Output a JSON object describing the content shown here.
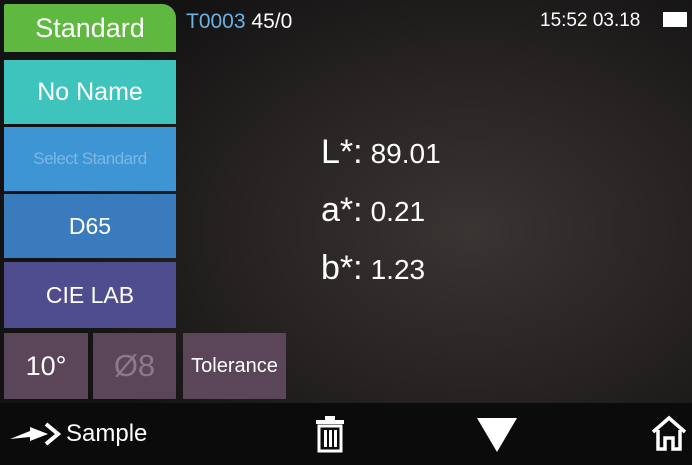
{
  "sidebar": {
    "standard_label": "Standard",
    "name_label": "No Name",
    "select_label": "Select Standard",
    "illuminant_label": "D65",
    "color_space_label": "CIE LAB",
    "observer_label": "10°",
    "aperture_label": "Ø8"
  },
  "tolerance_label": "Tolerance",
  "status": {
    "test_id": "T0003",
    "count": "45/0",
    "time": "15:52",
    "date": "03.18",
    "battery_level": 1.0
  },
  "readings": [
    {
      "label": "L*:",
      "value": "89.01"
    },
    {
      "label": "a*:",
      "value": "0.21"
    },
    {
      "label": "b*:",
      "value": "1.23"
    }
  ],
  "bottom": {
    "sample_label": "Sample"
  },
  "colors": {
    "standard": "#5fb83f",
    "name": "#3fc4bd",
    "select": "#3e95d3",
    "illuminant": "#3a7bbe",
    "color_space": "#4f4d8e",
    "tab": "#5a4559",
    "test_id": "#6ab1e6"
  },
  "icons": [
    "arrow-right-icon",
    "trash-icon",
    "triangle-down-icon",
    "home-icon",
    "battery-icon"
  ]
}
